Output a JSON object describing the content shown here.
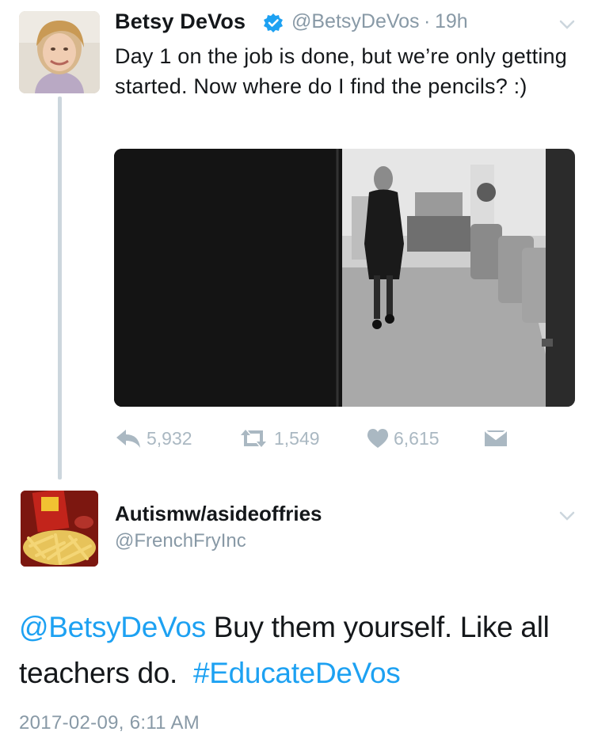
{
  "tweet": {
    "author_name": "Betsy DeVos",
    "handle": "@BetsyDeVos",
    "separator": "·",
    "time_ago": "19h",
    "text": "Day 1 on the job is done, but we’re only getting started. Now where do I find the pencils? :)",
    "stats": {
      "replies": "5,932",
      "retweets": "1,549",
      "likes": "6,615"
    },
    "icons": [
      "verified-icon",
      "menu-chevron-icon",
      "reply-icon",
      "retweet-icon",
      "like-icon",
      "message-icon"
    ]
  },
  "reply": {
    "author_name": "Autismw/asideoffries",
    "handle": "@FrenchFryInc",
    "mention": "@BetsyDeVos",
    "text_main": " Buy them yourself. Like all teachers do.  ",
    "hashtag": "#EducateDeVos",
    "timestamp": "2017-02-09, 6:11 AM"
  },
  "colors": {
    "link": "#1da1f2",
    "muted": "#8899a6",
    "action_gray": "#aab8c2",
    "thread_line": "#ccd6dd",
    "text": "#14171a"
  }
}
